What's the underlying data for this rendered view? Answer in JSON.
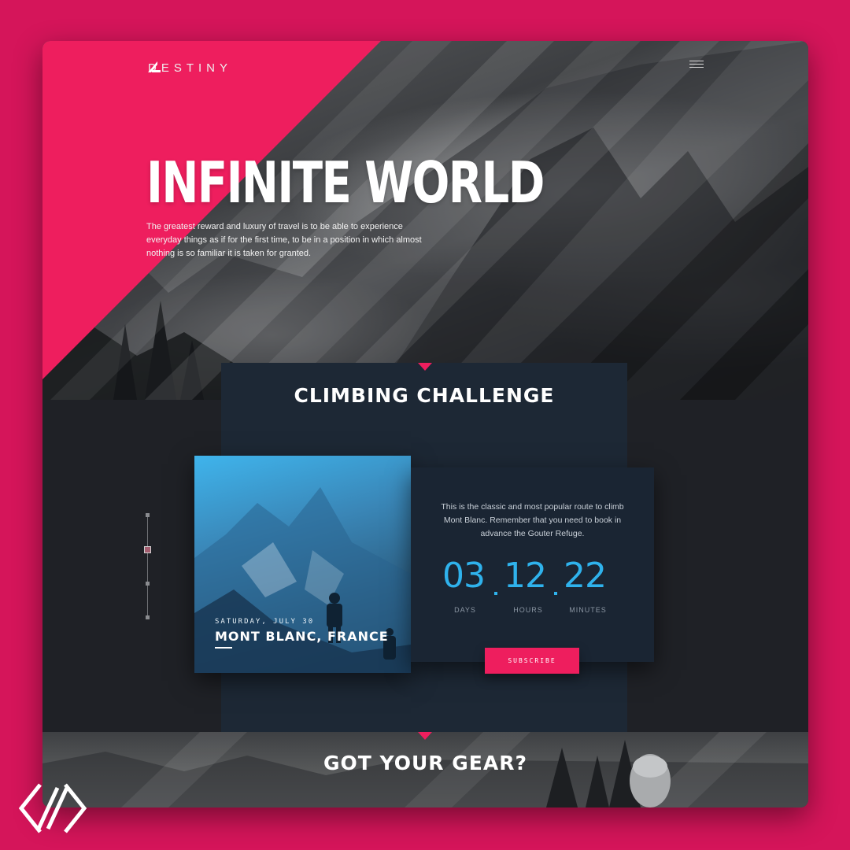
{
  "brand": {
    "logo_text": "DESTINY"
  },
  "hero": {
    "title": "INFINITE WORLD",
    "description": "The greatest reward and luxury of travel is to be able to experience everyday things as if for the first time, to be in a position in which almost nothing is so familiar it is taken for granted."
  },
  "challenge": {
    "title": "CLIMBING CHALLENGE",
    "card": {
      "date": "SATURDAY, JULY 30",
      "place": "MONT BLANC, FRANCE"
    },
    "description": "This is the classic and most popular route to climb Mont Blanc. Remember that you need to book in advance the Gouter Refuge.",
    "countdown": [
      {
        "value": "03",
        "label": "DAYS"
      },
      {
        "value": "12",
        "label": "HOURS"
      },
      {
        "value": "22",
        "label": "MINUTES"
      }
    ],
    "subscribe_label": "SUBSCRIBE"
  },
  "slider": {
    "dots": 4,
    "active_index": 1
  },
  "gear": {
    "title": "GOT YOUR GEAR?"
  },
  "colors": {
    "accent": "#ee1e5e",
    "background": "#d5155a",
    "countdown": "#2fb2ec",
    "panel": "#1d2835"
  },
  "icons": [
    "logo-mark-icon",
    "hamburger-menu-icon",
    "brand-watermark-icon"
  ]
}
